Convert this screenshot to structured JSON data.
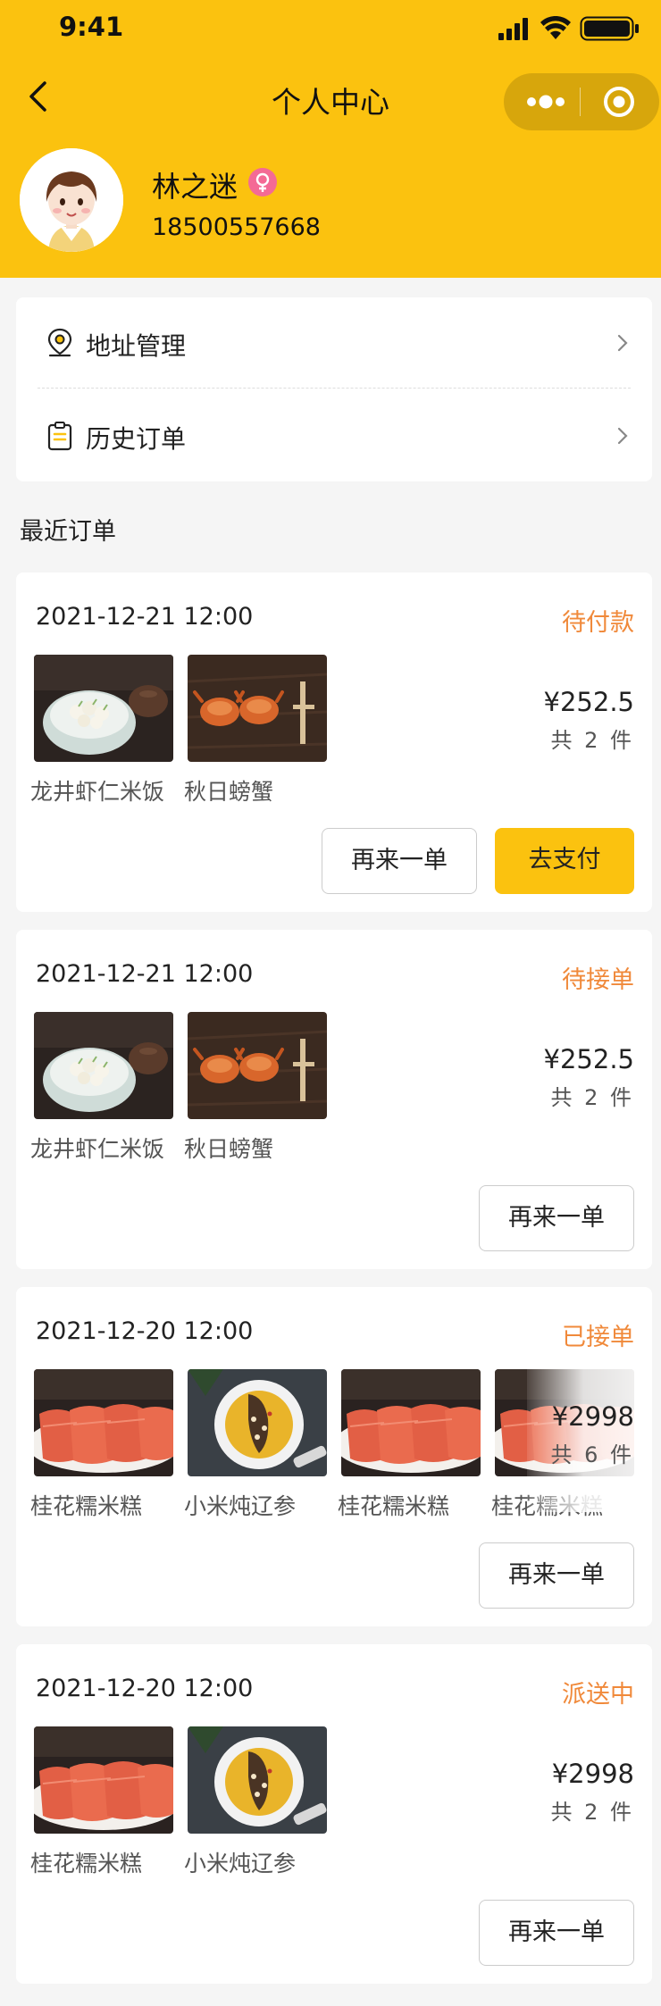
{
  "status_bar": {
    "time": "9:41"
  },
  "nav": {
    "title": "个人中心"
  },
  "user": {
    "name": "林之迷",
    "phone": "18500557668"
  },
  "menu": [
    {
      "label": "地址管理",
      "icon": "location-pin-icon"
    },
    {
      "label": "历史订单",
      "icon": "clipboard-icon"
    }
  ],
  "section_title": "最近订单",
  "orders": [
    {
      "date": "2021-12-21 12:00",
      "status": "待付款",
      "items": [
        {
          "name": "龙井虾仁米饭",
          "image": "shrimp-dish"
        },
        {
          "name": "秋日螃蟹",
          "image": "crab-dish"
        }
      ],
      "price": "¥252.5",
      "count": "共 2 件",
      "buttons": {
        "reorder": "再来一单",
        "pay": "去支付"
      }
    },
    {
      "date": "2021-12-21 12:00",
      "status": "待接单",
      "items": [
        {
          "name": "龙井虾仁米饭",
          "image": "shrimp-dish"
        },
        {
          "name": "秋日螃蟹",
          "image": "crab-dish"
        }
      ],
      "price": "¥252.5",
      "count": "共 2 件",
      "buttons": {
        "reorder": "再来一单"
      }
    },
    {
      "date": "2021-12-20 12:00",
      "status": "已接单",
      "items": [
        {
          "name": "桂花糯米糕",
          "image": "rice-cake-dish"
        },
        {
          "name": "小米炖辽参",
          "image": "sea-cucumber-dish"
        },
        {
          "name": "桂花糯米糕",
          "image": "rice-cake-dish"
        },
        {
          "name": "桂花糯米糕",
          "image": "rice-cake-dish"
        }
      ],
      "price": "¥2998",
      "count": "共 6 件",
      "buttons": {
        "reorder": "再来一单"
      }
    },
    {
      "date": "2021-12-20 12:00",
      "status": "派送中",
      "items": [
        {
          "name": "桂花糯米糕",
          "image": "rice-cake-dish"
        },
        {
          "name": "小米炖辽参",
          "image": "sea-cucumber-dish"
        }
      ],
      "price": "¥2998",
      "count": "共 2 件",
      "buttons": {
        "reorder": "再来一单"
      }
    }
  ],
  "colors": {
    "brand": "#fbc20f",
    "status": "#f0893a",
    "background": "#f5f5f5"
  }
}
